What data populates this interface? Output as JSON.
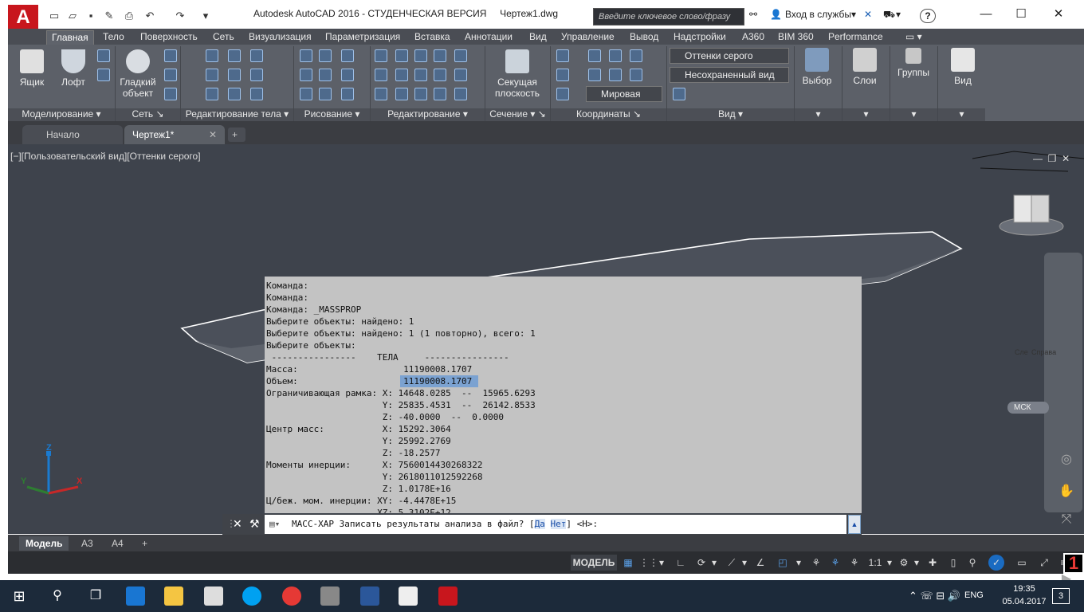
{
  "app": {
    "title": "Autodesk AutoCAD 2016 - СТУДЕНЧЕСКАЯ ВЕРСИЯ",
    "filename": "Чертеж1.dwg",
    "logo": "A",
    "search_placeholder": "Введите ключевое слово/фразу",
    "signin": "Вход в службы",
    "help": "?"
  },
  "ribbon_tabs": [
    "Главная",
    "Тело",
    "Поверхность",
    "Сеть",
    "Визуализация",
    "Параметризация",
    "Вставка",
    "Аннотации",
    "Вид",
    "Управление",
    "Вывод",
    "Надстройки",
    "A360",
    "BIM 360",
    "Performance"
  ],
  "ribbon": {
    "btn_box": "Ящик",
    "btn_loft": "Лофт",
    "btn_smooth_1": "Гладкий",
    "btn_smooth_2": "объект",
    "btn_section_1": "Секущая",
    "btn_section_2": "плоскость",
    "btn_select": "Выбор",
    "btn_layers": "Слои",
    "btn_groups": "Группы",
    "btn_view": "Вид",
    "combo_visual": "Оттенки серого",
    "combo_view": "Несохраненный вид",
    "combo_world": "Мировая",
    "panels": [
      "Моделирование",
      "Сеть",
      "Редактирование тела",
      "Рисование",
      "Редактирование",
      "Сечение",
      "Координаты",
      "Вид"
    ]
  },
  "doc_tabs": {
    "start": "Начало",
    "drawing": "Чертеж1*",
    "add": "+"
  },
  "viewport": {
    "label": "[−][Пользовательский вид][Оттенки серого]",
    "cube_left": "Сле",
    "cube_right": "Справа",
    "ucs": "МСК",
    "axis_x": "X",
    "axis_y": "Y",
    "axis_z": "Z"
  },
  "command_history": [
    "Команда:",
    "Команда:",
    "Команда: _MASSPROP",
    "Выберите объекты: найдено: 1",
    "Выберите объекты: найдено: 1 (1 повторно), всего: 1",
    "Выберите объекты:",
    " ----------------    ТЕЛА     ----------------",
    "Масса:                    11190008.1707",
    "Объем:                    11190008.1707",
    "Ограничивающая рамка: X: 14648.0285  --  15965.6293",
    "                      Y: 25835.4531  --  26142.8533",
    "                      Z: -40.0000  --  0.0000",
    "Центр масс:           X: 15292.3064",
    "                      Y: 25992.2769",
    "                      Z: -18.2577",
    "Моменты инерции:      X: 7560014430268322",
    "                      Y: 2618011012592268",
    "                      Z: 1.0178E+16",
    "Ц/беж. мом. инерции: XY: -4.4478E+15",
    "                     XZ: 5.3102E+12"
  ],
  "command_line": {
    "prefix": "МАСС-ХАР Записать результаты анализа в файл? [",
    "yes": "Да",
    "no": "Нет",
    "suffix": "] <Н>:"
  },
  "layout_tabs": [
    "Модель",
    "A3",
    "A4",
    "+"
  ],
  "status": {
    "model": "МОДЕЛЬ",
    "scale": "1:1"
  },
  "taskbar": {
    "lang": "ENG",
    "time": "19:35",
    "date": "05.04.2017",
    "badge": "3"
  }
}
